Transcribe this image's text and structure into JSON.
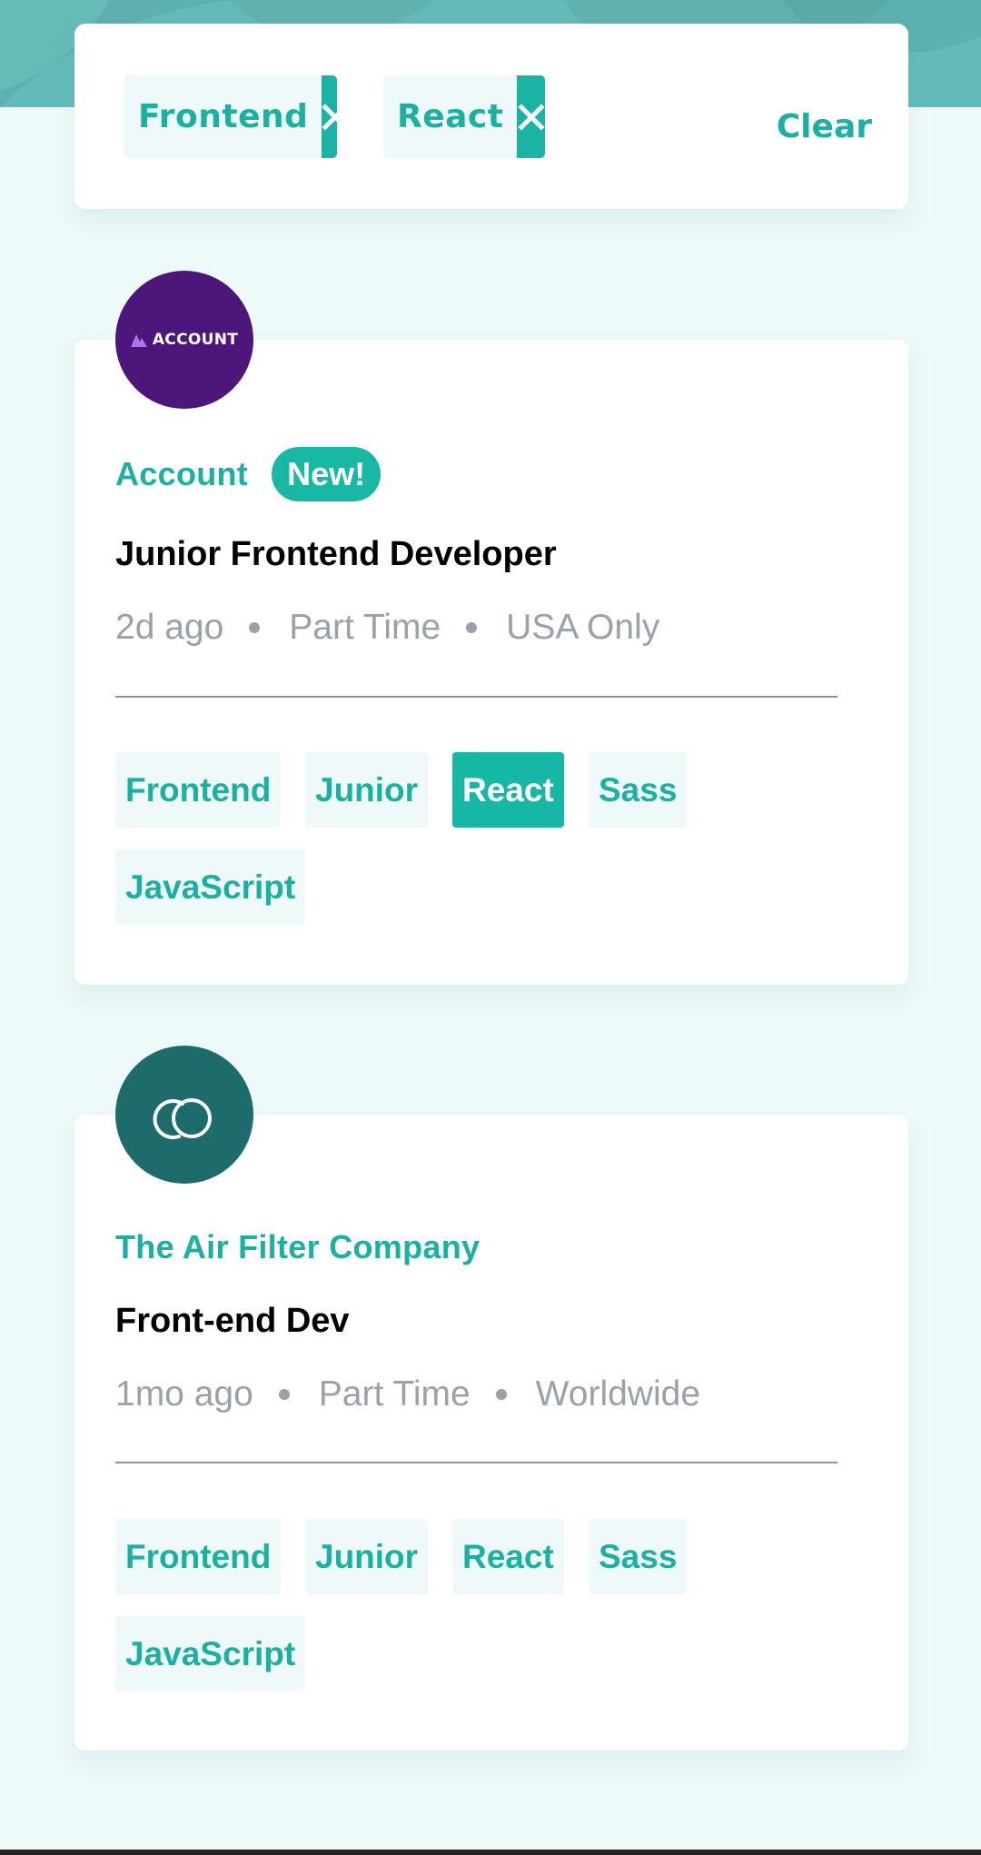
{
  "filters": {
    "active": [
      {
        "label": "Frontend"
      },
      {
        "label": "React"
      }
    ],
    "clear_label": "Clear"
  },
  "jobs": [
    {
      "logo_text": "ACCOUNT",
      "logo_icon": "account-logo-icon",
      "company": "Account",
      "badge": "New!",
      "title": "Junior Frontend Developer",
      "posted": "2d ago",
      "contract": "Part Time",
      "location": "USA Only",
      "tags": [
        {
          "label": "Frontend",
          "active": false
        },
        {
          "label": "Junior",
          "active": false
        },
        {
          "label": "React",
          "active": true
        },
        {
          "label": "Sass",
          "active": false
        },
        {
          "label": "JavaScript",
          "active": false
        }
      ]
    },
    {
      "logo_icon": "air-filter-logo-icon",
      "company": "The Air Filter Company",
      "title": "Front-end Dev",
      "posted": "1mo ago",
      "contract": "Part Time",
      "location": "Worldwide",
      "tags": [
        {
          "label": "Frontend",
          "active": false
        },
        {
          "label": "Junior",
          "active": false
        },
        {
          "label": "React",
          "active": false
        },
        {
          "label": "Sass",
          "active": false
        },
        {
          "label": "JavaScript",
          "active": false
        }
      ]
    }
  ],
  "colors": {
    "accent": "#1bb1a2",
    "accent_solid": "#17b7a5",
    "background": "#eef9f9",
    "header": "#63bab9",
    "account_logo": "#4c167a",
    "air_filter_logo": "#1d6b6b",
    "muted_text": "#9aa1a8"
  }
}
